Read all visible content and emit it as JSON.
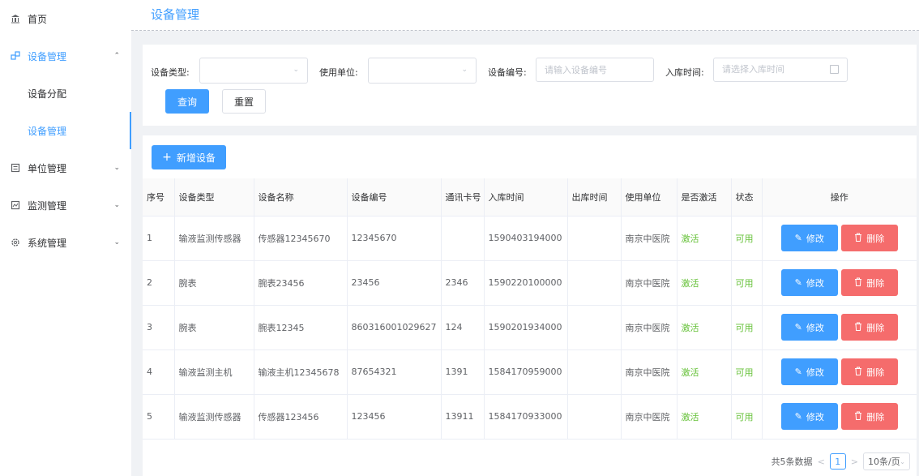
{
  "sidebar": {
    "items": [
      {
        "label": "首页",
        "icon": "bank-icon"
      },
      {
        "label": "设备管理",
        "icon": "devices-icon",
        "open": true,
        "children": [
          {
            "label": "设备分配"
          },
          {
            "label": "设备管理",
            "active": true
          }
        ]
      },
      {
        "label": "单位管理",
        "icon": "unit-icon"
      },
      {
        "label": "监测管理",
        "icon": "monitor-icon"
      },
      {
        "label": "系统管理",
        "icon": "gear-icon"
      }
    ]
  },
  "header": {
    "title": "设备管理"
  },
  "filters": {
    "device_type_label": "设备类型:",
    "device_type_value": "",
    "unit_label": "使用单位:",
    "unit_value": "",
    "device_no_label": "设备编号:",
    "device_no_placeholder": "请输入设备编号",
    "date_label": "入库时间:",
    "date_placeholder": "请选择入库时间",
    "search_button": "查询",
    "reset_button": "重置"
  },
  "toolbar": {
    "add_button": "新增设备"
  },
  "table": {
    "columns": [
      "序号",
      "设备类型",
      "设备名称",
      "设备编号",
      "通讯卡号",
      "入库时间",
      "出库时间",
      "使用单位",
      "是否激活",
      "状态",
      "操作"
    ],
    "rows": [
      {
        "index": "1",
        "type": "输液监测传感器",
        "name": "传感器12345670",
        "device_no": "12345670",
        "card": "",
        "in_time": "1590403194000",
        "out_time": "",
        "unit": "南京中医院",
        "activated": "激活",
        "status": "可用"
      },
      {
        "index": "2",
        "type": "腕表",
        "name": "腕表23456",
        "device_no": "23456",
        "card": "2346",
        "in_time": "1590220100000",
        "out_time": "",
        "unit": "南京中医院",
        "activated": "激活",
        "status": "可用"
      },
      {
        "index": "3",
        "type": "腕表",
        "name": "腕表12345",
        "device_no": "860316001029627",
        "card": "124",
        "in_time": "1590201934000",
        "out_time": "",
        "unit": "南京中医院",
        "activated": "激活",
        "status": "可用"
      },
      {
        "index": "4",
        "type": "输液监测主机",
        "name": "输液主机12345678",
        "device_no": "87654321",
        "card": "1391",
        "in_time": "1584170959000",
        "out_time": "",
        "unit": "南京中医院",
        "activated": "激活",
        "status": "可用"
      },
      {
        "index": "5",
        "type": "输液监测传感器",
        "name": "传感器123456",
        "device_no": "123456",
        "card": "13911",
        "in_time": "1584170933000",
        "out_time": "",
        "unit": "南京中医院",
        "activated": "激活",
        "status": "可用"
      }
    ],
    "edit_label": "修改",
    "delete_label": "删除"
  },
  "pagination": {
    "total_text": "共5条数据",
    "current_page": "1",
    "page_size": "10条/页"
  },
  "colors": {
    "primary": "#409eff",
    "danger": "#f56c6c",
    "success": "#67c23a"
  }
}
